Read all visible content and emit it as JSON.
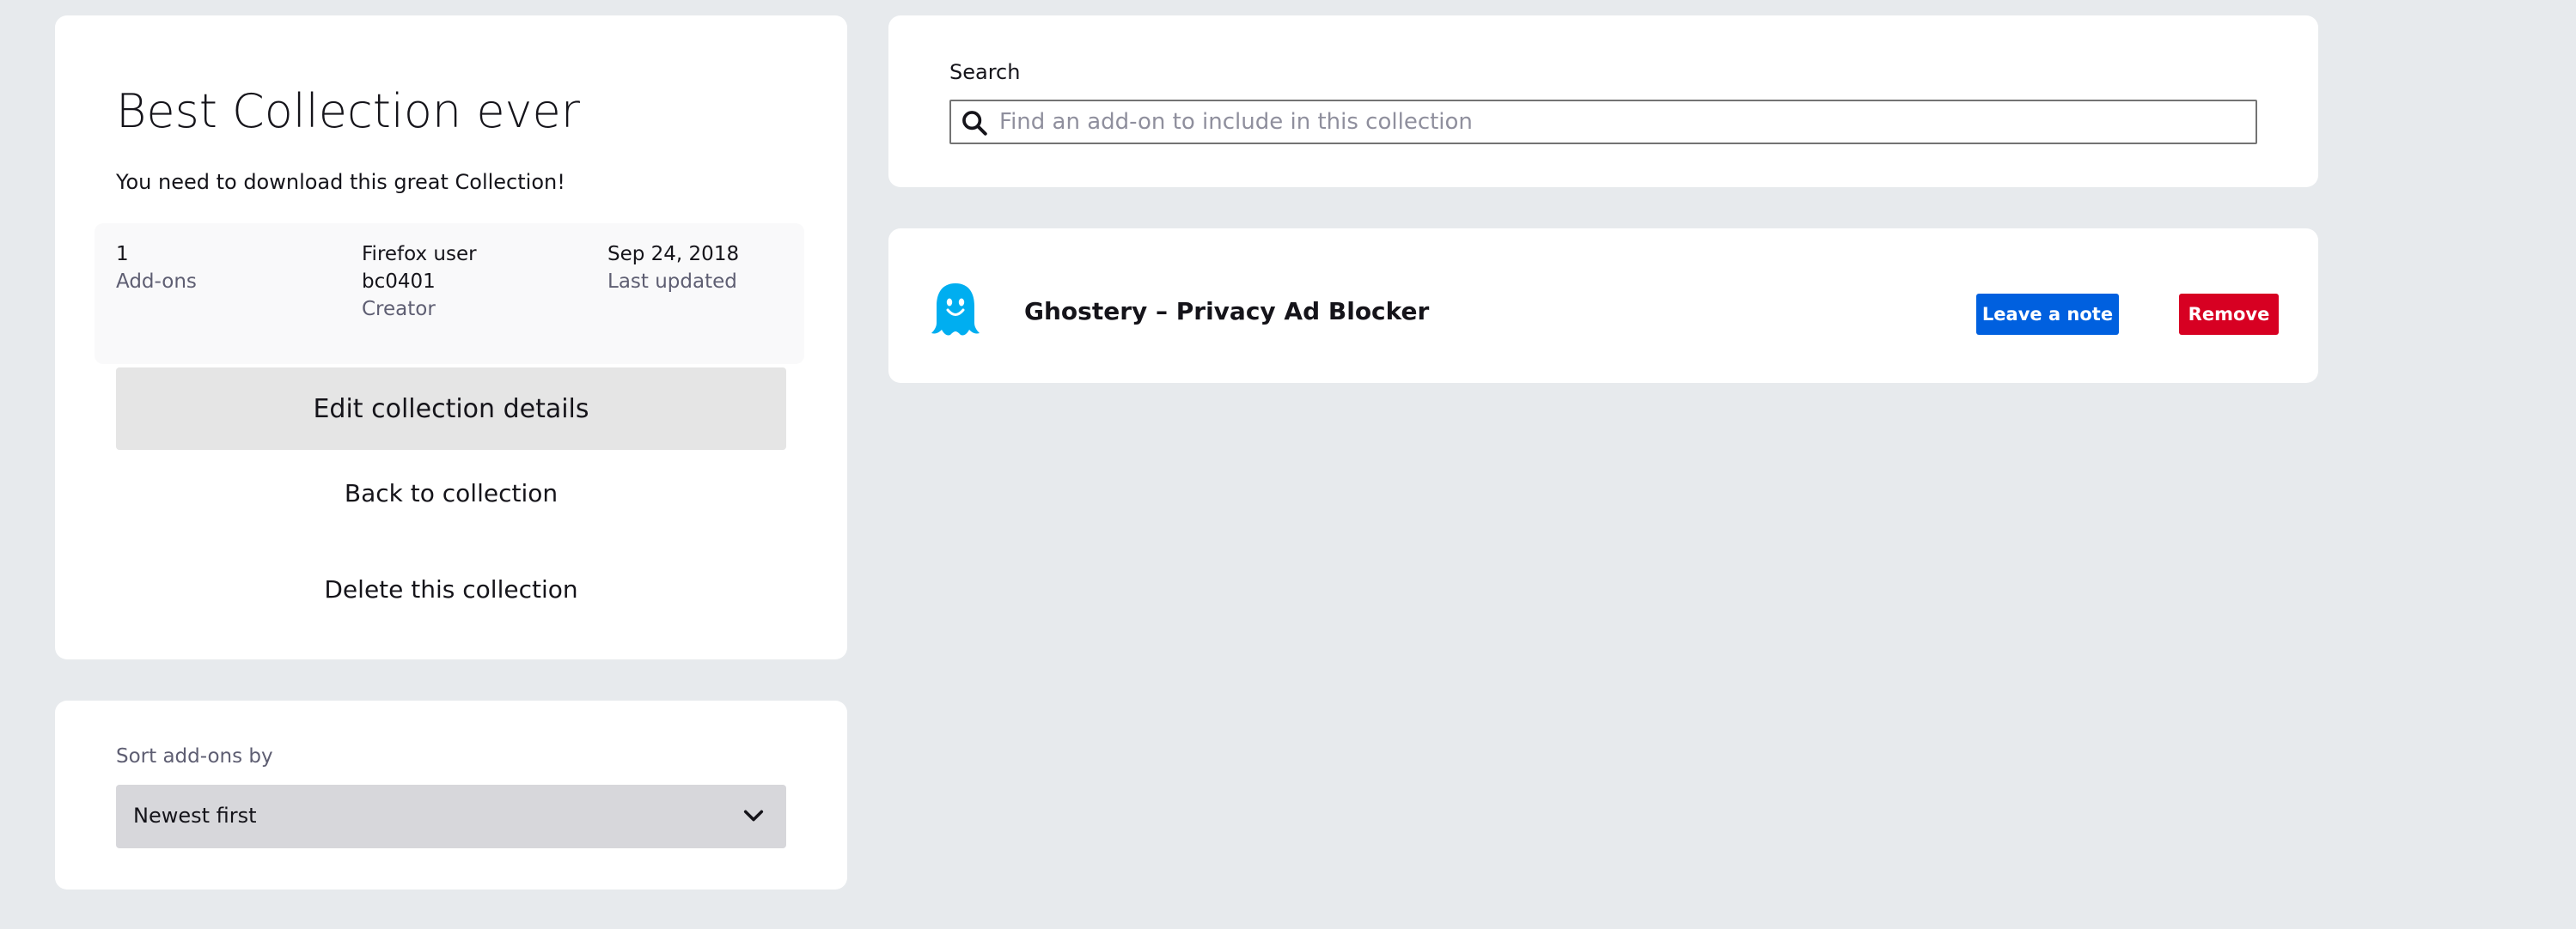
{
  "collection": {
    "title": "Best Collection ever",
    "description": "You need to download this great Collection!",
    "metadata": {
      "addons_count": "1",
      "addons_label": "Add-ons",
      "creator_line1": "Firefox user",
      "creator_line2": "bc0401",
      "creator_label": "Creator",
      "updated_value": "Sep 24, 2018",
      "updated_label": "Last updated"
    },
    "edit_button_label": "Edit collection details",
    "back_link_label": "Back to collection",
    "delete_link_label": "Delete this collection"
  },
  "sort": {
    "label": "Sort add-ons by",
    "selected": "Newest first",
    "chevron_icon": "chevron-down-icon"
  },
  "search": {
    "label": "Search",
    "placeholder": "Find an add-on to include in this collection",
    "value": "",
    "icon": "search-icon"
  },
  "addons": [
    {
      "name": "Ghostery – Privacy Ad Blocker",
      "icon": "ghost-icon",
      "note_button_label": "Leave a note",
      "remove_button_label": "Remove"
    }
  ],
  "colors": {
    "background": "#e7eaed",
    "card": "#ffffff",
    "primary_button": "#0060df",
    "danger_button": "#d70022",
    "ghost_icon": "#00aef0"
  }
}
